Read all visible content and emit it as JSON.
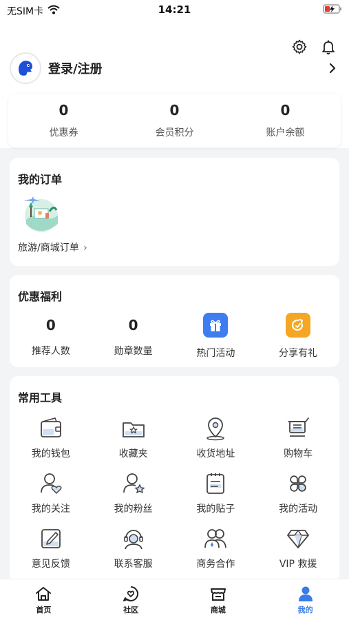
{
  "status_bar": {
    "carrier": "无SIM卡",
    "time": "14:21"
  },
  "profile": {
    "login_label": "登录/注册"
  },
  "stats": [
    {
      "value": "0",
      "label": "优惠券"
    },
    {
      "value": "0",
      "label": "会员积分"
    },
    {
      "value": "0",
      "label": "账户余额"
    }
  ],
  "orders": {
    "title": "我的订单",
    "link_label": "旅游/商城订单",
    "link_arrow": "›"
  },
  "benefits": {
    "title": "优惠福利",
    "items": [
      {
        "value": "0",
        "label": "推荐人数"
      },
      {
        "value": "0",
        "label": "勋章数量"
      },
      {
        "label": "热门活动",
        "icon": "gift-icon",
        "color": "#3d7df0"
      },
      {
        "label": "分享有礼",
        "icon": "share-icon",
        "color": "#f5a623"
      }
    ]
  },
  "tools": {
    "title": "常用工具",
    "items": [
      {
        "label": "我的钱包",
        "icon": "wallet-icon"
      },
      {
        "label": "收藏夹",
        "icon": "favorites-folder-icon"
      },
      {
        "label": "收货地址",
        "icon": "location-pin-icon"
      },
      {
        "label": "购物车",
        "icon": "shopping-cart-icon"
      },
      {
        "label": "我的关注",
        "icon": "user-heart-icon"
      },
      {
        "label": "我的粉丝",
        "icon": "user-star-icon"
      },
      {
        "label": "我的贴子",
        "icon": "post-document-icon"
      },
      {
        "label": "我的活动",
        "icon": "activity-grid-icon"
      },
      {
        "label": "意见反馈",
        "icon": "feedback-edit-icon"
      },
      {
        "label": "联系客服",
        "icon": "customer-service-icon"
      },
      {
        "label": "商务合作",
        "icon": "business-users-icon"
      },
      {
        "label": "VIP 救援",
        "icon": "vip-diamond-icon"
      }
    ]
  },
  "tabbar": {
    "items": [
      {
        "label": "首页",
        "icon": "home-icon"
      },
      {
        "label": "社区",
        "icon": "community-icon"
      },
      {
        "label": "商城",
        "icon": "store-icon"
      },
      {
        "label": "我的",
        "icon": "profile-icon"
      }
    ],
    "active_color": "#3a7be6"
  }
}
